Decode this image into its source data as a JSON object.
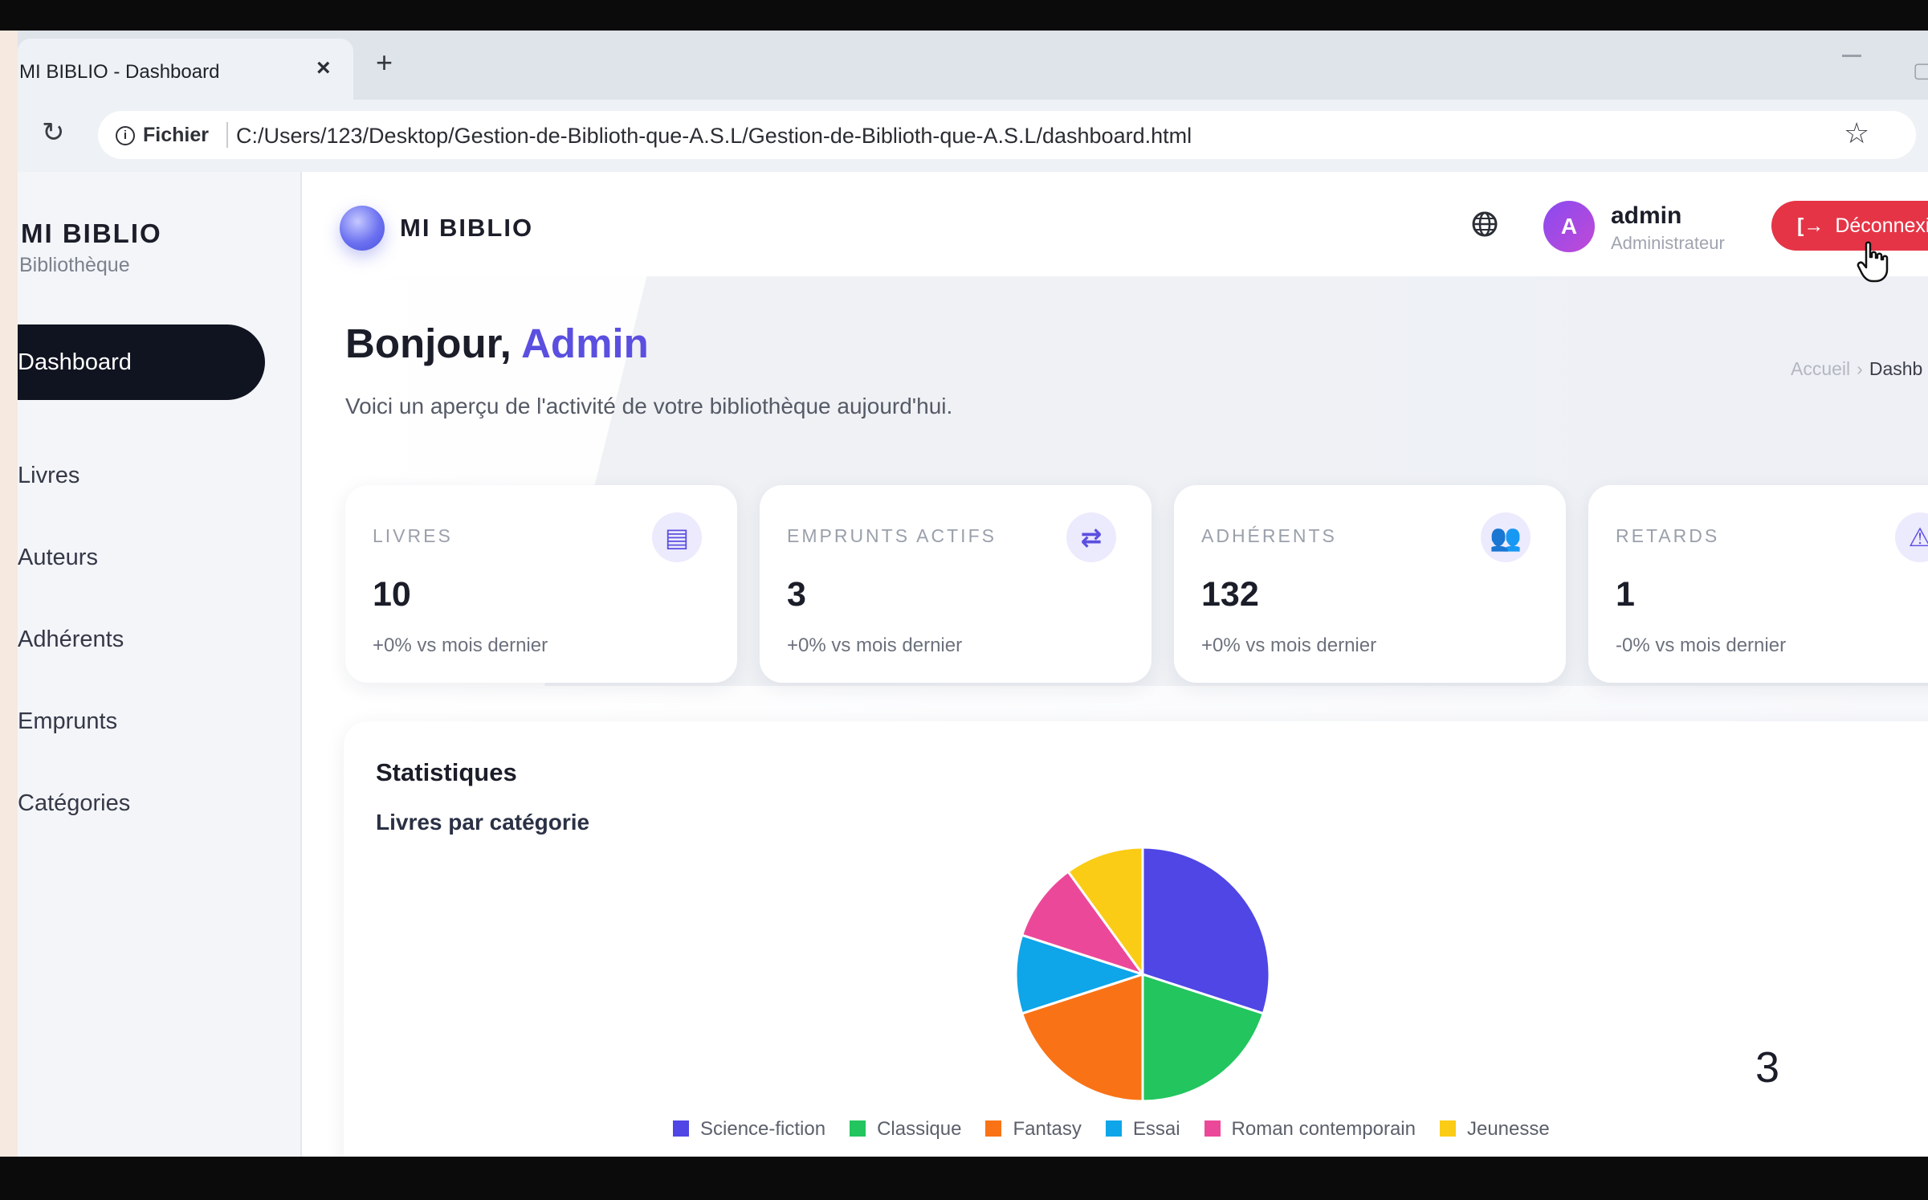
{
  "browser": {
    "tab_title": "MI BIBLIO - Dashboard",
    "tab_close": "×",
    "new_tab": "+",
    "address_label": "Fichier",
    "url": "C:/Users/123/Desktop/Gestion-de-Biblioth-que-A.S.L/Gestion-de-Biblioth-que-A.S.L/dashboard.html"
  },
  "sidebar": {
    "brand": "MI BIBLIO",
    "subtitle": "Bibliothèque",
    "items": [
      {
        "label": "Dashboard",
        "active": true
      },
      {
        "label": "Livres"
      },
      {
        "label": "Auteurs"
      },
      {
        "label": "Adhérents"
      },
      {
        "label": "Emprunts"
      },
      {
        "label": "Catégories"
      }
    ]
  },
  "header": {
    "brand": "MI BIBLIO",
    "avatar_initial": "A",
    "user_name": "admin",
    "user_role": "Administrateur",
    "logout_label": "Déconnexi"
  },
  "page": {
    "greeting": "Bonjour, ",
    "greeting_name": "Admin",
    "subtitle": "Voici un aperçu de l'activité de votre bibliothèque aujourd'hui.",
    "breadcrumb_home": "Accueil",
    "breadcrumb_sep": "›",
    "breadcrumb_current": "Dashb"
  },
  "cards": [
    {
      "label": "LIVRES",
      "value": "10",
      "trend": "+0% vs mois dernier",
      "icon": "book-icon"
    },
    {
      "label": "EMPRUNTS ACTIFS",
      "value": "3",
      "trend": "+0% vs mois dernier",
      "icon": "exchange-icon"
    },
    {
      "label": "ADHÉRENTS",
      "value": "132",
      "trend": "+0% vs mois dernier",
      "icon": "users-icon"
    },
    {
      "label": "RETARDS",
      "value": "1",
      "trend": "-0% vs mois dernier",
      "icon": "warning-icon"
    }
  ],
  "stats": {
    "title": "Statistiques",
    "subtitle": "Livres par catégorie"
  },
  "chart_data": {
    "type": "pie",
    "categories": [
      "Science-fiction",
      "Classique",
      "Fantasy",
      "Essai",
      "Roman contemporain",
      "Jeunesse"
    ],
    "values": [
      3,
      2,
      2,
      1,
      1,
      1
    ],
    "colors": [
      "#4f46e5",
      "#22c55e",
      "#f97316",
      "#0ea5e9",
      "#ec4899",
      "#facc15"
    ],
    "legend": "bottom"
  },
  "page_number": "3"
}
